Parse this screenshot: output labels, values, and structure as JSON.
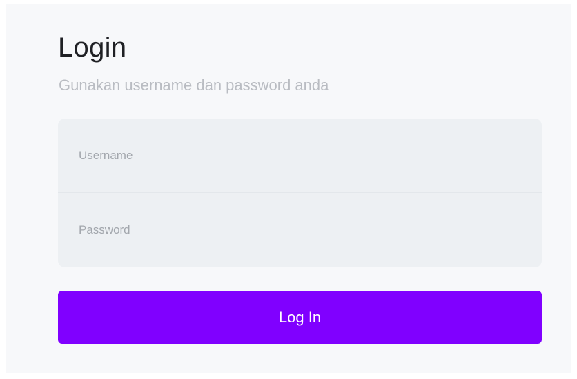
{
  "login": {
    "title": "Login",
    "subtitle": "Gunakan username dan password anda",
    "username_placeholder": "Username",
    "username_value": "",
    "password_placeholder": "Password",
    "password_value": "",
    "button_label": "Log In"
  },
  "colors": {
    "accent": "#8000ff",
    "panel_background": "#f7f8fa",
    "field_background": "#edf0f3"
  }
}
